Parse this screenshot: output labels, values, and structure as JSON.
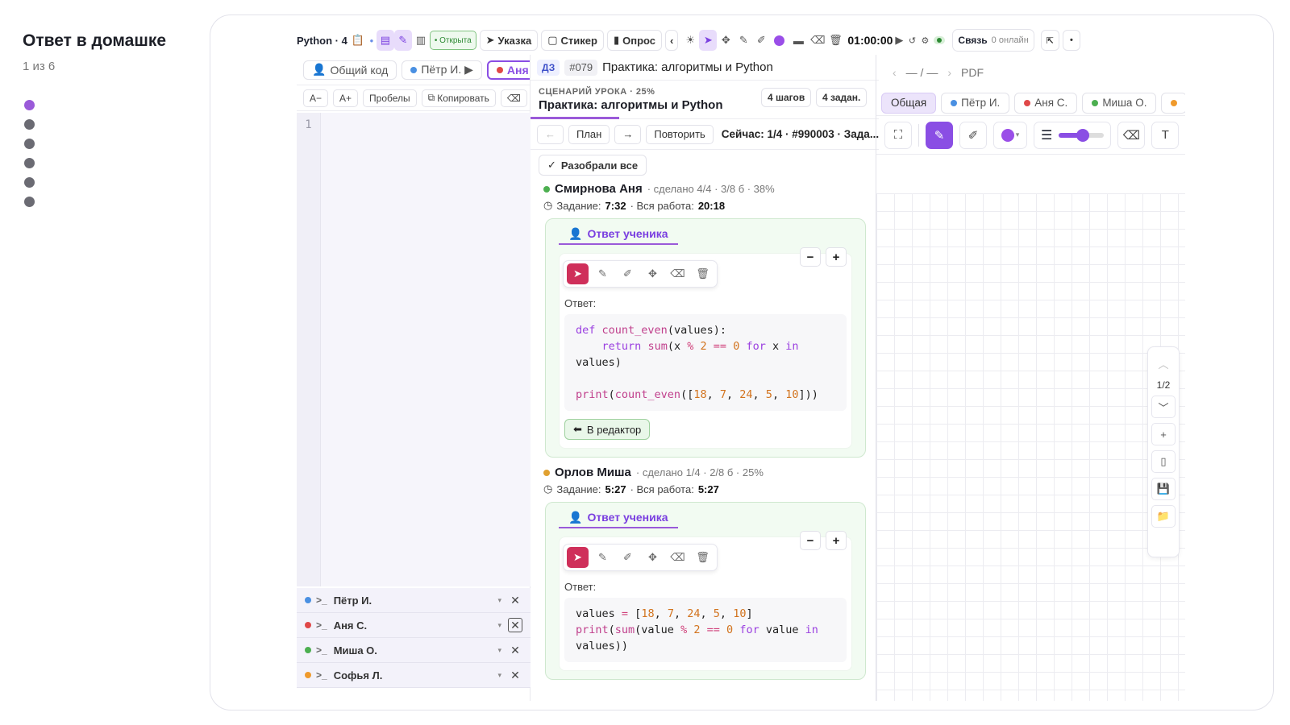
{
  "slide": {
    "title": "Ответ в домашке",
    "counter": "1 из 6",
    "dots": 6,
    "active_dot": 0,
    "accent": "#9a5ad9"
  },
  "toolbar": {
    "language": "Python · 4",
    "status_open": "• Открыта",
    "btn_pointer": "Указка",
    "btn_sticker": "Стикер",
    "btn_poll": "Опрос",
    "timer": "01:00:00",
    "connection": "Связь",
    "online": "0 онлайн"
  },
  "code_panel": {
    "tabs": [
      {
        "label": "Общий код",
        "icon": "user-icon",
        "color": ""
      },
      {
        "label": "Пётр И. ▶",
        "icon": "dot",
        "color": "#4a90e2"
      },
      {
        "label": "Аня С",
        "icon": "dot",
        "color": "#e04848"
      }
    ],
    "tools": {
      "font_minus": "A−",
      "font_plus": "A+",
      "spaces": "Пробелы",
      "copy": "Копировать"
    },
    "line_number": "1",
    "terminals": [
      {
        "name": "Пётр И.",
        "color": "#4a90e2"
      },
      {
        "name": "Аня С.",
        "color": "#e04848"
      },
      {
        "name": "Миша О.",
        "color": "#4caf50"
      },
      {
        "name": "Софья Л.",
        "color": "#ef9a2d"
      }
    ]
  },
  "lesson": {
    "hw_tag": "ДЗ",
    "hw_number": "#079",
    "hw_title": "Практика: алгоритмы и Python",
    "scenario_label": "СЦЕНАРИЙ УРОКА · 25%",
    "scenario_title": "Практика: алгоритмы и Python",
    "steps_badge": "4 шагов",
    "tasks_badge": "4 задан.",
    "nav_back": "←",
    "nav_plan": "План",
    "nav_forward": "→",
    "nav_repeat": "Повторить",
    "now_text": "Сейчас: 1/4 · #990003 · Зада...",
    "all_done": "Разобрали все",
    "students": [
      {
        "name": "Смирнова Аня",
        "color": "#4caf50",
        "meta": "· сделано 4/4 · 3/8 б · 38%",
        "task_label": "Задание:",
        "task_time": "7:32",
        "work_label": "· Вся работа:",
        "work_time": "20:18",
        "answer_tab": "Ответ ученика",
        "answer_label": "Ответ:",
        "editor_button": "В редактор"
      },
      {
        "name": "Орлов Миша",
        "color": "#e0a030",
        "meta": "· сделано 1/4 · 2/8 б · 25%",
        "task_label": "Задание:",
        "task_time": "5:27",
        "work_label": "· Вся работа:",
        "work_time": "5:27",
        "answer_tab": "Ответ ученика",
        "answer_label": "Ответ:"
      }
    ]
  },
  "board": {
    "page_indicator": "— / —",
    "pdf_label": "PDF",
    "tabs": [
      {
        "label": "Общая",
        "color": ""
      },
      {
        "label": "Пётр И.",
        "color": "#4a90e2"
      },
      {
        "label": "Аня С.",
        "color": "#e04848"
      },
      {
        "label": "Миша О.",
        "color": "#4caf50"
      }
    ],
    "pen_color": "#9a4ee8",
    "page_counter": "1/2"
  }
}
